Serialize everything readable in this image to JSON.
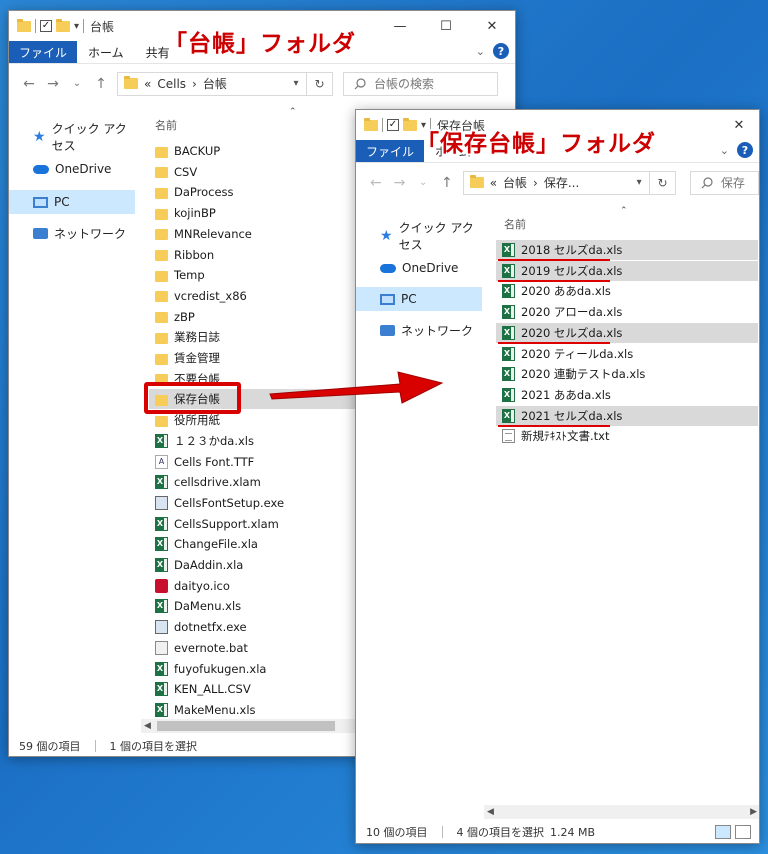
{
  "left_window": {
    "title": "台帳",
    "ribbon_tabs": [
      "ファイル",
      "ホーム",
      "共有"
    ],
    "address": [
      "«",
      "Cells",
      "›",
      "台帳"
    ],
    "search_placeholder": "台帳の検索",
    "nav": [
      "クイック アクセス",
      "OneDrive",
      "PC",
      "ネットワーク"
    ],
    "column_header": "名前",
    "items": [
      {
        "name": "BACKUP",
        "icon": "folder"
      },
      {
        "name": "CSV",
        "icon": "folder"
      },
      {
        "name": "DaProcess",
        "icon": "folder"
      },
      {
        "name": "kojinBP",
        "icon": "folder"
      },
      {
        "name": "MNRelevance",
        "icon": "folder"
      },
      {
        "name": "Ribbon",
        "icon": "folder"
      },
      {
        "name": "Temp",
        "icon": "folder"
      },
      {
        "name": "vcredist_x86",
        "icon": "folder"
      },
      {
        "name": "zBP",
        "icon": "folder"
      },
      {
        "name": "業務日誌",
        "icon": "folder"
      },
      {
        "name": "賃金管理",
        "icon": "folder"
      },
      {
        "name": "不要台帳",
        "icon": "folder"
      },
      {
        "name": "保存台帳",
        "icon": "folder"
      },
      {
        "name": "役所用紙",
        "icon": "folder"
      },
      {
        "name": "１２３かda.xls",
        "icon": "excel"
      },
      {
        "name": "Cells Font.TTF",
        "icon": "font"
      },
      {
        "name": "cellsdrive.xlam",
        "icon": "excel"
      },
      {
        "name": "CellsFontSetup.exe",
        "icon": "exe"
      },
      {
        "name": "CellsSupport.xlam",
        "icon": "excel"
      },
      {
        "name": "ChangeFile.xla",
        "icon": "excel"
      },
      {
        "name": "DaAddin.xla",
        "icon": "excel"
      },
      {
        "name": "daityo.ico",
        "icon": "ico"
      },
      {
        "name": "DaMenu.xls",
        "icon": "excel"
      },
      {
        "name": "dotnetfx.exe",
        "icon": "exe"
      },
      {
        "name": "evernote.bat",
        "icon": "bat"
      },
      {
        "name": "fuyofukugen.xla",
        "icon": "excel"
      },
      {
        "name": "KEN_ALL.CSV",
        "icon": "excel"
      },
      {
        "name": "MakeMenu.xls",
        "icon": "excel"
      }
    ],
    "status_count": "59 個の項目",
    "status_selected": "1 個の項目を選択"
  },
  "right_window": {
    "title": "保存台帳",
    "ribbon_tabs": [
      "ファイル",
      "ホーム"
    ],
    "address": [
      "«",
      "台帳",
      "›",
      "保存..."
    ],
    "search_placeholder": "保存",
    "nav": [
      "クイック アクセス",
      "OneDrive",
      "PC",
      "ネットワーク"
    ],
    "column_header": "名前",
    "items": [
      {
        "name": "2018 セルズda.xls",
        "icon": "excel"
      },
      {
        "name": "2019 セルズda.xls",
        "icon": "excel"
      },
      {
        "name": "2020 ああda.xls",
        "icon": "excel"
      },
      {
        "name": "2020 アローda.xls",
        "icon": "excel"
      },
      {
        "name": "2020 セルズda.xls",
        "icon": "excel"
      },
      {
        "name": "2020 ティールda.xls",
        "icon": "excel"
      },
      {
        "name": "2020 連動テストda.xls",
        "icon": "excel"
      },
      {
        "name": "2021 ああda.xls",
        "icon": "excel"
      },
      {
        "name": "2021 セルズda.xls",
        "icon": "excel"
      },
      {
        "name": "新規ﾃｷｽﾄ文書.txt",
        "icon": "text"
      }
    ],
    "highlighted_indices": [
      0,
      1,
      4,
      8
    ],
    "status_count": "10 個の項目",
    "status_selected": "4 個の項目を選択",
    "status_size": "1.24 MB"
  },
  "annotations": {
    "left_label": "「台帳」フォルダ",
    "right_label": "「保存台帳」フォルダ"
  },
  "colors": {
    "accent": "#1a5eb8",
    "highlight": "#d9d9d9",
    "annotation_red": "#d00000"
  }
}
